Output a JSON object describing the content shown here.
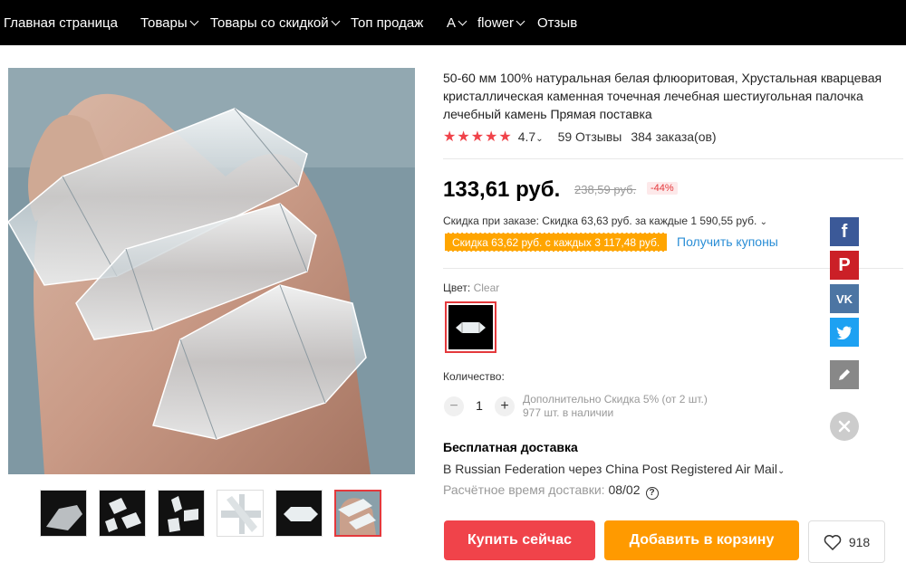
{
  "nav": {
    "items": [
      {
        "label": "Главная страница",
        "dropdown": false
      },
      {
        "label": "Товары",
        "dropdown": true
      },
      {
        "label": "Товары со скидкой",
        "dropdown": true
      },
      {
        "label": "Топ продаж",
        "dropdown": false
      },
      {
        "label": "A",
        "dropdown": true
      },
      {
        "label": "flower",
        "dropdown": true
      },
      {
        "label": "Отзыв",
        "dropdown": false
      }
    ]
  },
  "product": {
    "title": "50-60 мм 100% натуральная белая флюоритовая, Хрустальная кварцевая кристаллическая каменная точечная лечебная шестиугольная палочка лечебный камень Прямая поставка",
    "stars": "★★★★★",
    "rating": "4.7",
    "reviews": "59 Отзывы",
    "orders": "384 заказа(ов)",
    "price": "133,61 руб.",
    "old_price": "238,59 руб.",
    "discount": "-44%",
    "order_discount": "Скидка при заказе: Скидка 63,63 руб. за каждые 1 590,55 руб.",
    "coupon": "Скидка 63,62 руб. с каждых 3 117,48 руб.",
    "get_coupons": "Получить купоны",
    "color_label": "Цвет:",
    "color_value": "Clear",
    "quantity_label": "Количество:",
    "quantity": "1",
    "quantity_discount": "Дополнительно Скидка 5% (от 2 шт.)",
    "stock": "977 шт. в наличии",
    "shipping_title": "Бесплатная доставка",
    "shipping_route": "В Russian Federation через China Post Registered Air Mail",
    "shipping_time_label": "Расчётное время доставки:",
    "shipping_date": "08/02",
    "buy_now": "Купить сейчас",
    "add_to_cart": "Добавить в корзину",
    "wishlist_count": "918"
  },
  "gallery": {
    "thumbnail_count": 6,
    "active_thumbnail": 6
  },
  "social": [
    "facebook-icon",
    "pinterest-icon",
    "vk-icon",
    "twitter-icon",
    "edit-icon",
    "close-icon"
  ],
  "colors": {
    "nav_bg": "#000000",
    "accent_red": "#f0434a",
    "accent_orange": "#ff9a00",
    "link_blue": "#2a8ed6"
  }
}
